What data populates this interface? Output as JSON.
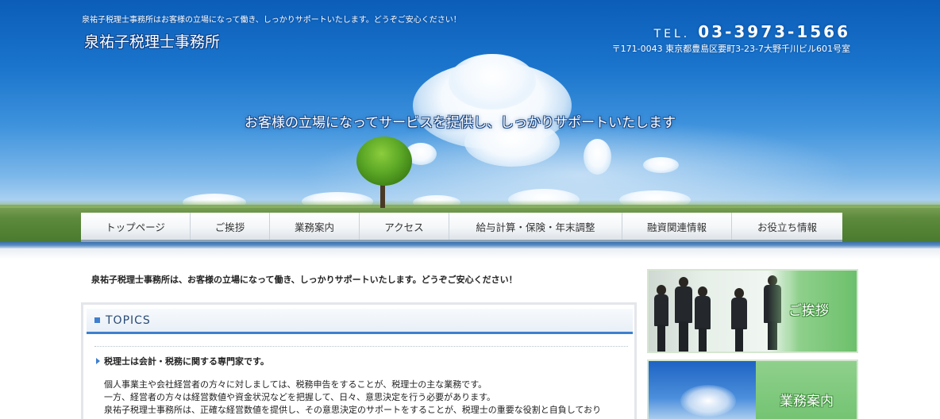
{
  "header": {
    "tagline": "泉祐子税理士事務所はお客様の立場になって働き、しっかりサポートいたします。どうぞご安心ください！",
    "brand": "泉祐子税理士事務所",
    "tel_label": "TEL.",
    "tel_number": "03-3973-1566",
    "address": "〒171-0043 東京都豊島区要町3-23-7大野千川ビル601号室",
    "catchphrase": "お客様の立場になってサービスを提供し、しっかりサポートいたします"
  },
  "nav": {
    "items": [
      {
        "label": "トップページ"
      },
      {
        "label": "ご挨拶"
      },
      {
        "label": "業務案内"
      },
      {
        "label": "アクセス"
      },
      {
        "label": "給与計算・保険・年末調整"
      },
      {
        "label": "融資関連情報"
      },
      {
        "label": "お役立ち情報"
      }
    ]
  },
  "main": {
    "intro": "泉祐子税理士事務所は、お客様の立場になって働き、しっかりサポートいたします。どうぞご安心ください！",
    "topics": {
      "title": "TOPICS",
      "headline": "税理士は会計・税務に関する専門家です。",
      "lines": [
        "個人事業主や会社経営者の方々に対しましては、税務申告をすることが、税理士の主な業務です。",
        "一方、経営者の方々は経営数値や資金状況などを把握して、日々、意思決定を行う必要があります。",
        "泉祐子税理士事務所は、正確な経営数値を提供し、その意思決定のサポートをすることが、税理士の重要な役割と自負しており"
      ]
    }
  },
  "sidebar": {
    "banners": [
      {
        "label": "ご挨拶"
      },
      {
        "label": "業務案内"
      }
    ]
  },
  "colors": {
    "accent": "#3e7fd0",
    "sky_top": "#0b5db8",
    "banner_green": "#6cc06b"
  }
}
